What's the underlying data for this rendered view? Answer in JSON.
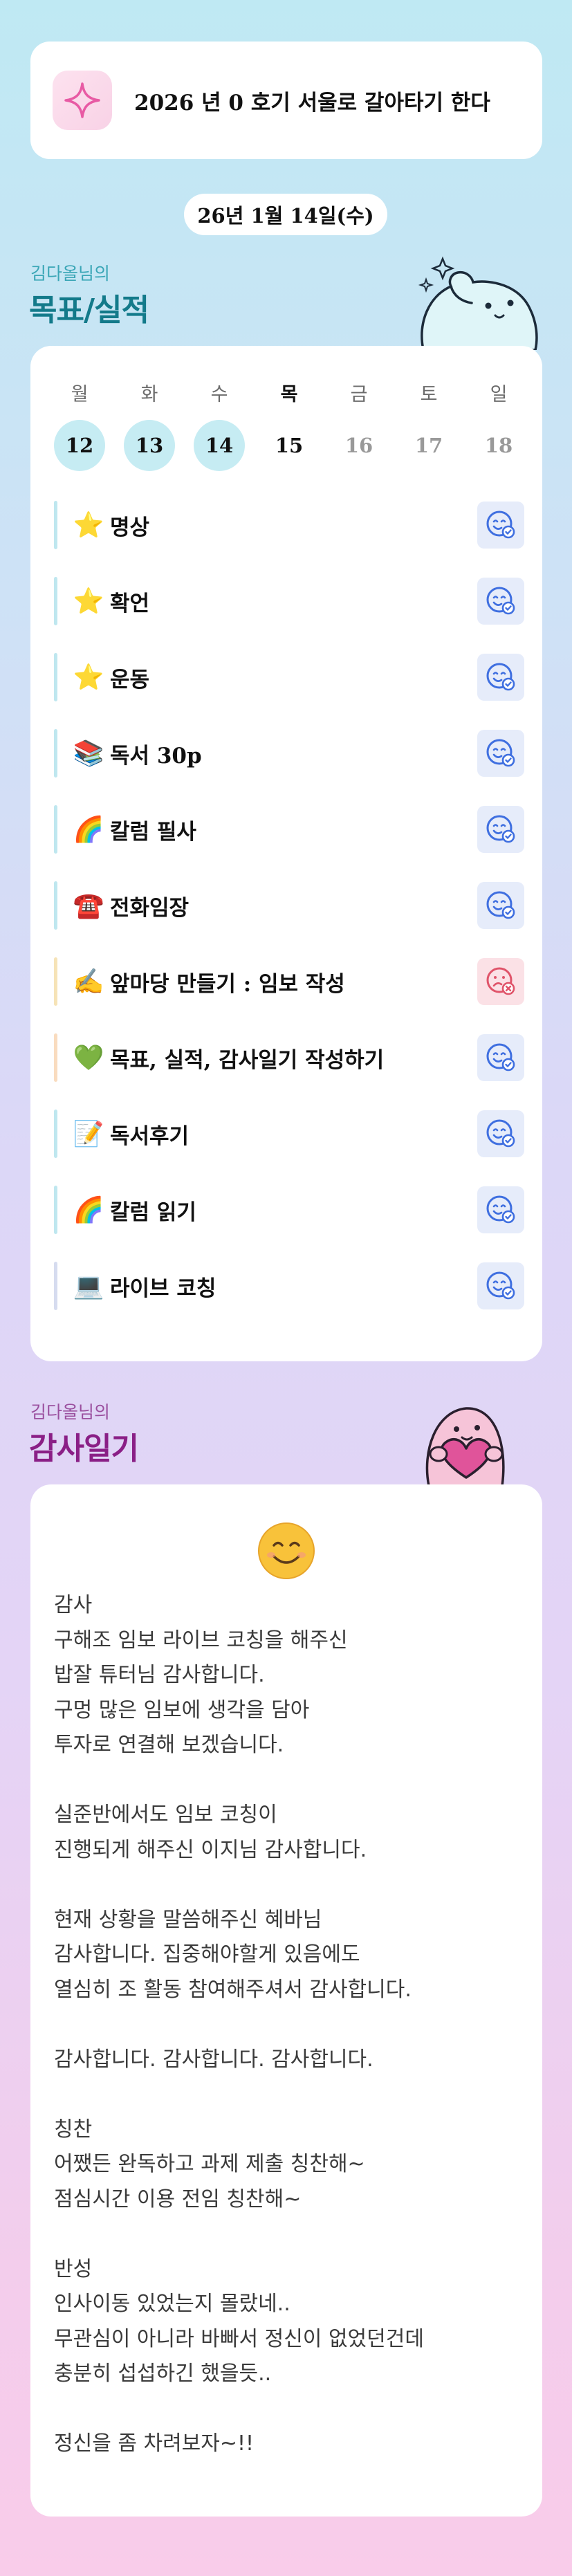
{
  "goal": {
    "icon": "sparkle-icon",
    "text": "2026 년 0 호기 서울로 갈아타기 한다"
  },
  "date": "26년 1월 14일(수)",
  "goals_section": {
    "owner": "김다올님의",
    "title": "목표/실적"
  },
  "calendar": {
    "weekdays": [
      "월",
      "화",
      "수",
      "목",
      "금",
      "토",
      "일"
    ],
    "days": [
      "12",
      "13",
      "14",
      "15",
      "16",
      "17",
      "18"
    ],
    "today_index": 3,
    "completed_indices": [
      0,
      1,
      2
    ]
  },
  "tasks": [
    {
      "emoji": "⭐",
      "label": "명상",
      "status": "done",
      "status_icon": "smile-check-icon",
      "bar_color": "#bfe7ef"
    },
    {
      "emoji": "⭐",
      "label": "확언",
      "status": "done",
      "status_icon": "smile-check-icon",
      "bar_color": "#bfe7ef"
    },
    {
      "emoji": "⭐",
      "label": "운동",
      "status": "done",
      "status_icon": "smile-check-icon",
      "bar_color": "#bfe7ef"
    },
    {
      "emoji": "📚",
      "label": "독서 30p",
      "status": "done",
      "status_icon": "smile-check-icon",
      "bar_color": "#bfe7ef"
    },
    {
      "emoji": "🌈",
      "label": "칼럼 필사",
      "status": "done",
      "status_icon": "smile-check-icon",
      "bar_color": "#bfe7ef"
    },
    {
      "emoji": "☎️",
      "label": "전화임장",
      "status": "done",
      "status_icon": "smile-check-icon",
      "bar_color": "#bfe7ef"
    },
    {
      "emoji": "✍️",
      "label": "앞마당 만들기 : 임보 작성",
      "status": "failed",
      "status_icon": "sad-x-icon",
      "bar_color": "#f6e3b7"
    },
    {
      "emoji": "💚",
      "label": "목표, 실적, 감사일기 작성하기",
      "status": "done",
      "status_icon": "smile-check-icon",
      "bar_color": "#f9dcbf"
    },
    {
      "emoji": "📝",
      "label": "독서후기",
      "status": "done",
      "status_icon": "smile-check-icon",
      "bar_color": "#bfe7ef"
    },
    {
      "emoji": "🌈",
      "label": "칼럼 읽기",
      "status": "done",
      "status_icon": "smile-check-icon",
      "bar_color": "#bfe7ef"
    },
    {
      "emoji": "💻",
      "label": "라이브 코칭",
      "status": "done",
      "status_icon": "smile-check-icon",
      "bar_color": "#d6dcef"
    }
  ],
  "gratitude_section": {
    "owner": "김다올님의",
    "title": "감사일기"
  },
  "journal": {
    "mood_icon": "😊",
    "lines": [
      "감사",
      "구해조 임보 라이브 코칭을 해주신",
      "밥잘 튜터님 감사합니다.",
      "구멍 많은 임보에 생각을 담아",
      "투자로 연결해 보겠습니다.",
      "",
      "실준반에서도 임보 코칭이",
      "진행되게 해주신 이지님 감사합니다.",
      "",
      "현재 상황을 말씀해주신 혜바님",
      "감사합니다. 집중해야할게 있음에도",
      "열심히 조 활동 참여해주셔서 감사합니다.",
      "",
      "감사합니다. 감사합니다. 감사합니다.",
      "",
      "칭찬",
      "어쨌든 완독하고 과제 제출 칭찬해~",
      "점심시간 이용 전임 칭찬해~",
      "",
      "반성",
      "인사이동 있었는지 몰랐네..",
      "무관심이 아니라 바빠서 정신이 없었던건데",
      "충분히 섭섭하긴 했을듯..",
      "",
      "정신을 좀 차려보자~!!"
    ]
  },
  "colors": {
    "goals_owner": "#3aa6b6",
    "goals_title": "#137a8a",
    "gratitude_owner": "#9a4f9e",
    "gratitude_title": "#8a1f86",
    "ok_icon": "#3f6fe0",
    "fail_icon": "#e0546a"
  }
}
